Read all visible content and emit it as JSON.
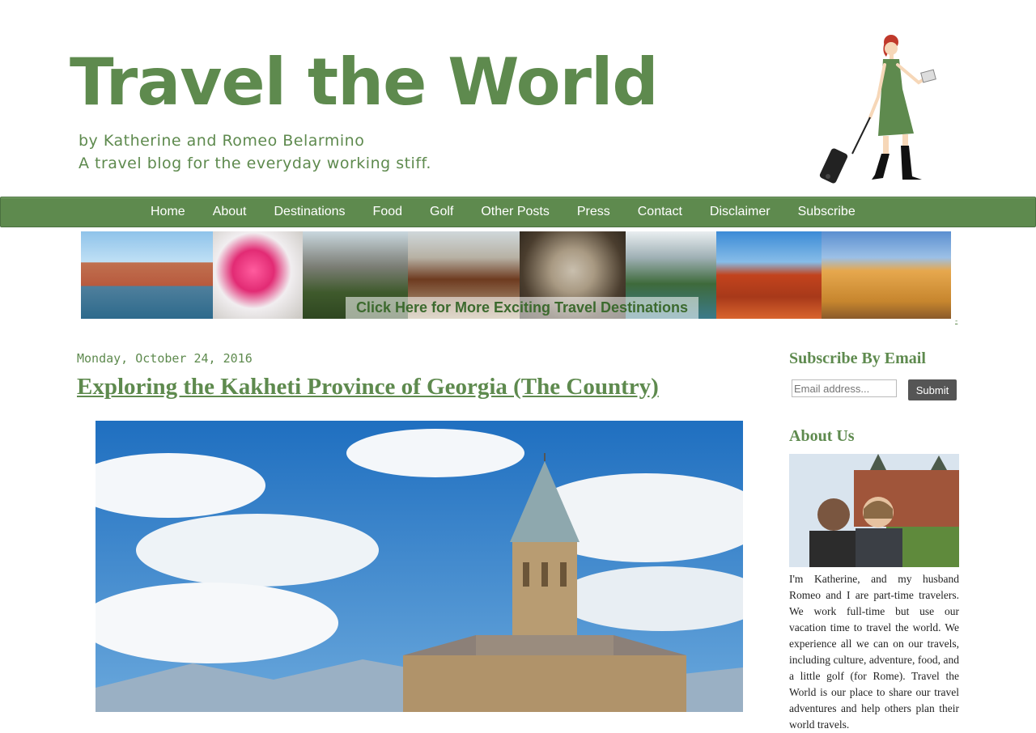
{
  "header": {
    "title": "Travel the World",
    "tagline_1": "by Katherine and Romeo Belarmino",
    "tagline_2": "A travel blog for the everyday working stiff."
  },
  "nav": {
    "items": [
      "Home",
      "About",
      "Destinations",
      "Food",
      "Golf",
      "Other Posts",
      "Press",
      "Contact",
      "Disclaimer",
      "Subscribe"
    ]
  },
  "banner": {
    "cta": "Click Here for More Exciting Travel Destinations",
    "tiny_link": "-"
  },
  "post": {
    "date": "Monday, October 24, 2016",
    "title": "Exploring the Kakheti Province of Georgia (The Country)"
  },
  "sidebar": {
    "subscribe_heading": "Subscribe By Email",
    "email_placeholder": "Email address...",
    "submit_label": "Submit",
    "about_heading": "About Us",
    "about_text": "I'm Katherine, and my husband Romeo and I are part-time travelers. We work full-time but use our vacation time to travel the world. We experience all we can on our travels, including culture, adventure, food, and a little golf (for Rome). Travel the World is our place to share our travel adventures and help others plan their world travels."
  },
  "colors": {
    "brand_green": "#5e8a4e",
    "nav_bg": "#5e8a4e",
    "button_bg": "#555555"
  }
}
